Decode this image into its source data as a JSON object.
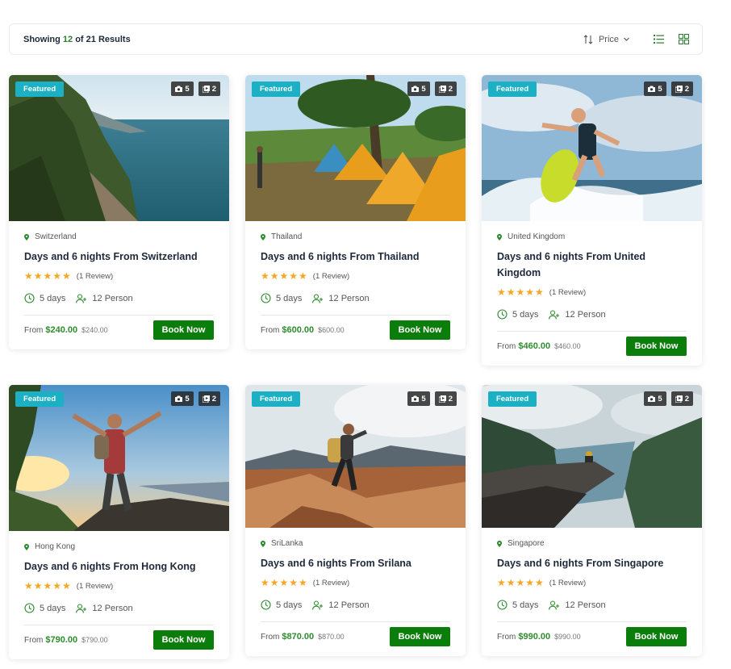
{
  "results": {
    "prefix": "Showing",
    "shown": "12",
    "middle": "of",
    "total": "21",
    "suffix": "Results"
  },
  "sort": {
    "label": "Price"
  },
  "colors": {
    "accent": "#0a7d0a",
    "badge": "#1bb0c4",
    "star": "#f5a623",
    "price": "#2e8b2e"
  },
  "cards": [
    {
      "badge": "Featured",
      "photos": "5",
      "videos": "2",
      "location": "Switzerland",
      "title": "Days and 6 nights From Switzerland",
      "stars": "★★★★★",
      "review": "(1 Review)",
      "duration": "5 days",
      "people": "12 Person",
      "from": "From",
      "price": "$240.00",
      "old_price": "$240.00",
      "button": "Book Now"
    },
    {
      "badge": "Featured",
      "photos": "5",
      "videos": "2",
      "location": "Thailand",
      "title": "Days and 6 nights From Thailand",
      "stars": "★★★★★",
      "review": "(1 Review)",
      "duration": "5 days",
      "people": "12 Person",
      "from": "From",
      "price": "$600.00",
      "old_price": "$600.00",
      "button": "Book Now"
    },
    {
      "badge": "Featured",
      "photos": "5",
      "videos": "2",
      "location": "United Kingdom",
      "title": "Days and 6 nights From United Kingdom",
      "stars": "★★★★★",
      "review": "(1 Review)",
      "duration": "5 days",
      "people": "12 Person",
      "from": "From",
      "price": "$460.00",
      "old_price": "$460.00",
      "button": "Book Now"
    },
    {
      "badge": "Featured",
      "photos": "5",
      "videos": "2",
      "location": "Hong Kong",
      "title": "Days and 6 nights From Hong Kong",
      "stars": "★★★★★",
      "review": "(1 Review)",
      "duration": "5 days",
      "people": "12 Person",
      "from": "From",
      "price": "$790.00",
      "old_price": "$790.00",
      "button": "Book Now"
    },
    {
      "badge": "Featured",
      "photos": "5",
      "videos": "2",
      "location": "SriLanka",
      "title": "Days and 6 nights From Srilana",
      "stars": "★★★★★",
      "review": "(1 Review)",
      "duration": "5 days",
      "people": "12 Person",
      "from": "From",
      "price": "$870.00",
      "old_price": "$870.00",
      "button": "Book Now"
    },
    {
      "badge": "Featured",
      "photos": "5",
      "videos": "2",
      "location": "Singapore",
      "title": "Days and 6 nights From Singapore",
      "stars": "★★★★★",
      "review": "(1 Review)",
      "duration": "5 days",
      "people": "12 Person",
      "from": "From",
      "price": "$990.00",
      "old_price": "$990.00",
      "button": "Book Now"
    }
  ]
}
